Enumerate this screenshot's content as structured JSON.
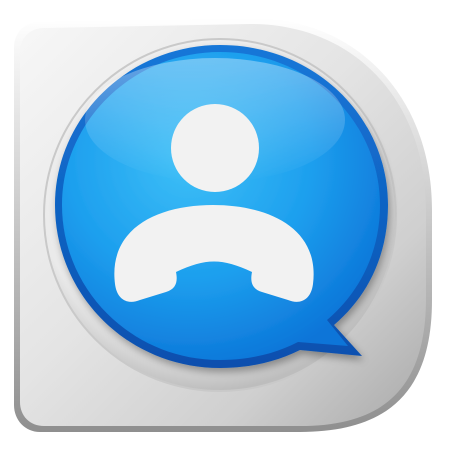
{
  "app_icon": {
    "icon": "contact-phone-chat-icon",
    "colors": {
      "background": "#ffffff",
      "plate_light": "#f6f6f6",
      "plate_mid": "#d9d9d9",
      "plate_dark": "#9c9c9c",
      "bubble_light": "#35b8f5",
      "bubble_mid": "#0d8fe6",
      "bubble_dark": "#0a5fc4",
      "glyph": "#f3f3f3"
    }
  }
}
